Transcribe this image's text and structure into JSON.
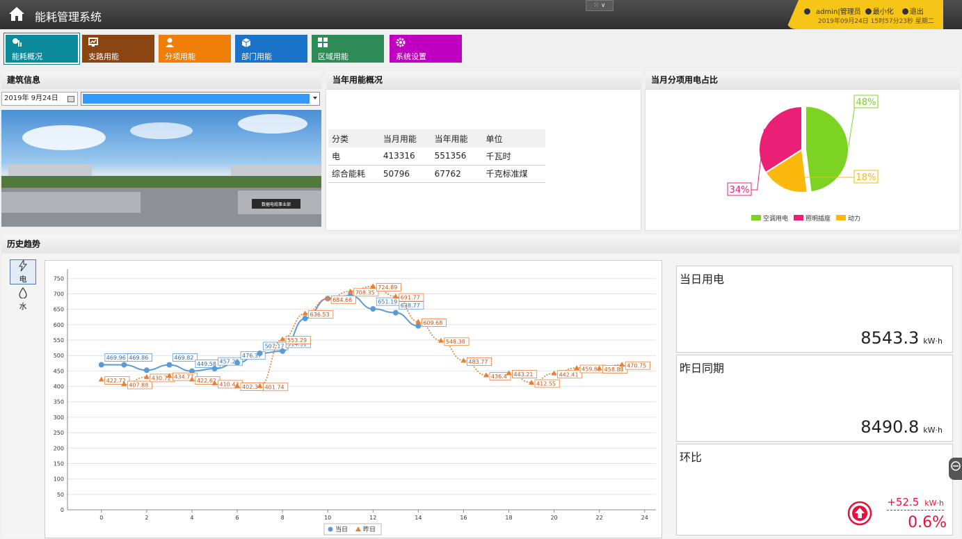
{
  "header": {
    "title": "能耗管理系统",
    "user": {
      "admin_label": "admin|管理员",
      "minimize_label": "最小化",
      "logout_label": "退出",
      "datetime": "2019年09月24日 15时57分23秒 星期二"
    }
  },
  "nav": {
    "items": [
      {
        "label": "能耗概况",
        "color": "#0a8a9a",
        "icon": "overview-icon"
      },
      {
        "label": "支路用能",
        "color": "#8b4513",
        "icon": "branch-icon"
      },
      {
        "label": "分项用能",
        "color": "#f07f09",
        "icon": "user-icon"
      },
      {
        "label": "部门用能",
        "color": "#1a73c8",
        "icon": "cube-icon"
      },
      {
        "label": "区域用能",
        "color": "#2e8b57",
        "icon": "grid-icon"
      },
      {
        "label": "系统设置",
        "color": "#c000c0",
        "icon": "gear-icon"
      }
    ]
  },
  "building": {
    "title": "建筑信息",
    "date": "2019年  9月24日",
    "photo_sign": "数据电缆事业部"
  },
  "overview": {
    "title": "当年用能概况",
    "columns": [
      "分类",
      "当月用能",
      "当年用能",
      "单位"
    ],
    "rows": [
      [
        "电",
        "413316",
        "551356",
        "千瓦时"
      ],
      [
        "综合能耗",
        "50796",
        "67762",
        "千克标准煤"
      ]
    ]
  },
  "pie": {
    "title": "当月分项用电占比",
    "slices": [
      {
        "name": "空调用电",
        "value": 48,
        "label": "48%",
        "color": "#7dd321"
      },
      {
        "name": "动力",
        "value": 18,
        "label": "18%",
        "color": "#fbb90e"
      },
      {
        "name": "照明插座",
        "value": 34,
        "label": "34%",
        "color": "#ea1f76"
      }
    ]
  },
  "history": {
    "title": "历史趋势",
    "tabs": [
      {
        "label": "电",
        "icon": "lightning-icon"
      },
      {
        "label": "水",
        "icon": "water-drop-icon"
      }
    ]
  },
  "chart_data": {
    "type": "line",
    "x_ticks": [
      0,
      2,
      4,
      6,
      8,
      10,
      12,
      14,
      16,
      18,
      20,
      22,
      24
    ],
    "y_ticks": [
      0,
      50,
      100,
      150,
      200,
      250,
      300,
      350,
      400,
      450,
      500,
      550,
      600,
      650,
      700,
      750
    ],
    "xlim": [
      -1.5,
      24.5
    ],
    "ylim": [
      0,
      780
    ],
    "grid": true,
    "legend": "bottom",
    "series": [
      {
        "name": "当日",
        "color": "#5b9bd5",
        "x": [
          0,
          1,
          2,
          3,
          4,
          5,
          6,
          7,
          8,
          9,
          10,
          11,
          12,
          13,
          14
        ],
        "values": [
          469.96,
          469.86,
          452.5,
          469.82,
          449.58,
          457.28,
          476.37,
          507.17,
          514.31,
          620.0,
          684.66,
          694.0,
          651.19,
          638.77,
          596.0
        ],
        "labels": [
          "469.96",
          "469.86",
          "",
          "469.82",
          "449.58",
          "457.28",
          "476.37",
          "507.17",
          "514.31",
          "",
          "",
          "",
          "651.19",
          "638.77",
          ""
        ]
      },
      {
        "name": "昨日",
        "color": "#ed7d31",
        "x": [
          0,
          1,
          2,
          3,
          4,
          5,
          6,
          7,
          8,
          9,
          10,
          11,
          12,
          13,
          14,
          15,
          16,
          17,
          18,
          19,
          20,
          21,
          22,
          23
        ],
        "values": [
          422.72,
          407.88,
          430.72,
          434.77,
          422.62,
          410.43,
          402.34,
          401.74,
          553.29,
          636.53,
          684.66,
          708.35,
          724.89,
          691.77,
          609.68,
          548.38,
          483.77,
          436.4,
          443.21,
          412.55,
          442.41,
          459.82,
          458.88,
          470.75
        ],
        "labels": [
          "422.72",
          "407.88",
          "430.72",
          "434.77",
          "422.62",
          "410.43",
          "402.34",
          "401.74",
          "553.29",
          "636.53",
          "684.66",
          "708.35",
          "724.89",
          "691.77",
          "609.68",
          "548.38",
          "483.77",
          "436.4",
          "443.21",
          "412.55",
          "442.41",
          "459.82",
          "458.88",
          "470.75"
        ]
      }
    ]
  },
  "kpis": {
    "today": {
      "title": "当日用电",
      "value": "8543.3",
      "unit": "kW·h"
    },
    "yesterday": {
      "title": "昨日同期",
      "value": "8490.8",
      "unit": "kW·h"
    },
    "ratio": {
      "title": "环比",
      "delta": "+52.5",
      "delta_unit": "kW·h",
      "percent": "0.6%"
    }
  },
  "colors": {
    "accent_red": "#e8103a"
  }
}
